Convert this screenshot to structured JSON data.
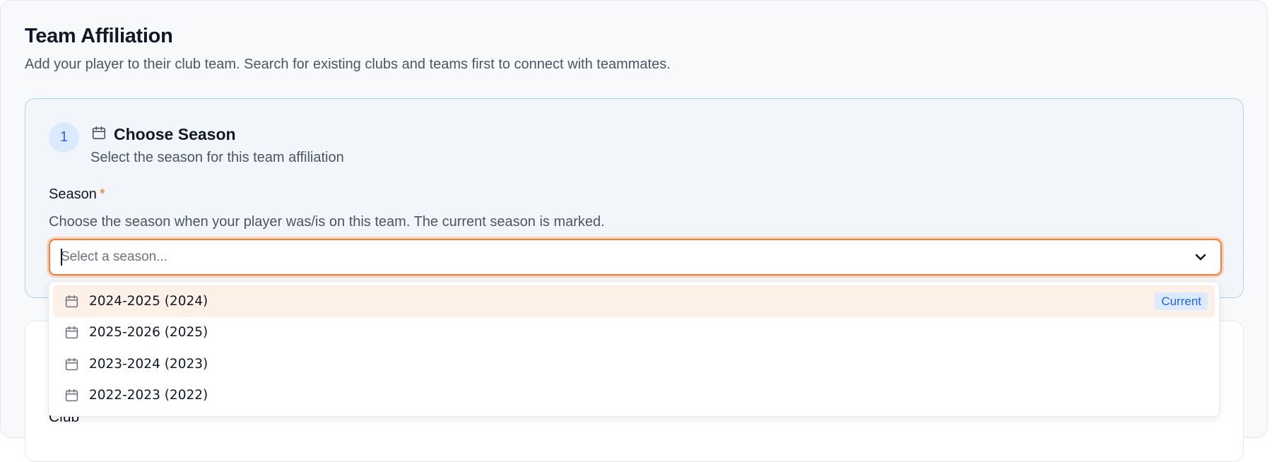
{
  "page": {
    "title": "Team Affiliation",
    "subtitle": "Add your player to their club team. Search for existing clubs and teams first to connect with teammates."
  },
  "step": {
    "number": "1",
    "icon": "calendar-icon",
    "title": "Choose Season",
    "description": "Select the season for this team affiliation"
  },
  "season_field": {
    "label": "Season",
    "required_mark": "*",
    "help": "Choose the season when your player was/is on this team. The current season is marked.",
    "placeholder": "Select a season...",
    "value": ""
  },
  "next_card": {
    "label": "Club"
  },
  "dropdown": {
    "options": [
      {
        "label": "2024-2025 (2024)",
        "icon": "calendar-icon",
        "badge": "Current",
        "highlighted": true
      },
      {
        "label": "2025-2026 (2025)",
        "icon": "calendar-icon"
      },
      {
        "label": "2023-2024 (2023)",
        "icon": "calendar-icon"
      },
      {
        "label": "2022-2023 (2022)",
        "icon": "calendar-icon"
      }
    ]
  },
  "colors": {
    "accent_orange": "#f27d3a",
    "step_blue": "#2563eb",
    "highlight": "#fdf0e7",
    "card_border": "#a9d4ee"
  }
}
